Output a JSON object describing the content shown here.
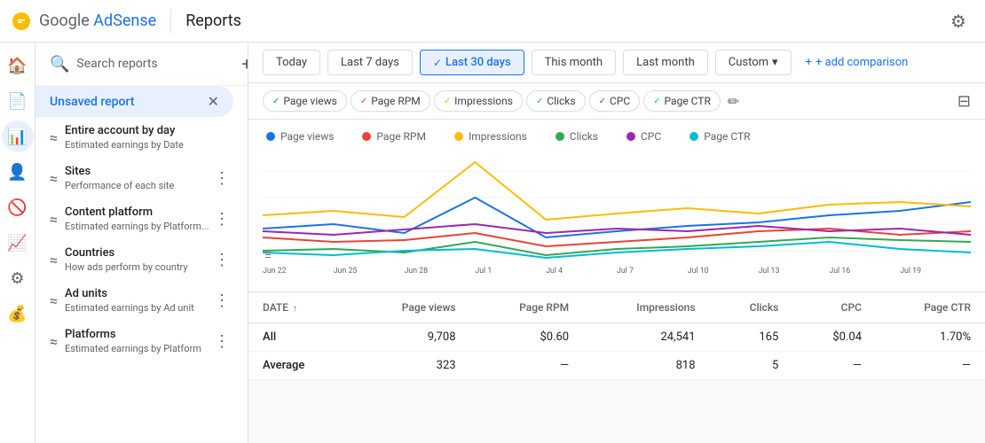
{
  "app": {
    "name": "Google AdSense",
    "page_title": "Reports",
    "settings_label": "Settings"
  },
  "date_filters": {
    "buttons": [
      {
        "id": "today",
        "label": "Today",
        "active": false
      },
      {
        "id": "last7",
        "label": "Last 7 days",
        "active": false
      },
      {
        "id": "last30",
        "label": "Last 30 days",
        "active": true
      },
      {
        "id": "thismonth",
        "label": "This month",
        "active": false
      },
      {
        "id": "lastmonth",
        "label": "Last month",
        "active": false
      },
      {
        "id": "custom",
        "label": "Custom",
        "active": false,
        "dropdown": true
      }
    ],
    "add_comparison_label": "+ add comparison"
  },
  "metric_tabs": [
    {
      "id": "pageviews",
      "label": "Page views",
      "active": true,
      "color": "#1a73e8"
    },
    {
      "id": "pagerpm",
      "label": "Page RPM",
      "active": true,
      "color": "#ea4335"
    },
    {
      "id": "impressions",
      "label": "Impressions",
      "active": true,
      "color": "#fbbc04"
    },
    {
      "id": "clicks",
      "label": "Clicks",
      "active": true,
      "color": "#34a853"
    },
    {
      "id": "cpc",
      "label": "CPC",
      "active": true,
      "color": "#9c27b0"
    },
    {
      "id": "pagectr",
      "label": "Page CTR",
      "active": true,
      "color": "#00bcd4"
    }
  ],
  "chart_legend": [
    {
      "label": "Page views",
      "color": "#1a73e8"
    },
    {
      "label": "Page RPM",
      "color": "#ea4335"
    },
    {
      "label": "Impressions",
      "color": "#fbbc04"
    },
    {
      "label": "Clicks",
      "color": "#34a853"
    },
    {
      "label": "CPC",
      "color": "#9c27b0"
    },
    {
      "label": "Page CTR",
      "color": "#00bcd4"
    }
  ],
  "chart_x_labels": [
    "Jun 22",
    "Jun 25",
    "Jun 28",
    "Jul 1",
    "Jul 4",
    "Jul 7",
    "Jul 10",
    "Jul 13",
    "Jul 16",
    "Jul 19"
  ],
  "table": {
    "columns": [
      "DATE",
      "Page views",
      "Page RPM",
      "Impressions",
      "Clicks",
      "CPC",
      "Page CTR"
    ],
    "rows": [
      {
        "date": "All",
        "pageviews": "9,708",
        "pagerpm": "$0.60",
        "impressions": "24,541",
        "clicks": "165",
        "cpc": "$0.04",
        "pagectr": "1.70%"
      },
      {
        "date": "Average",
        "pageviews": "323",
        "pagerpm": "—",
        "impressions": "818",
        "clicks": "5",
        "cpc": "—",
        "pagectr": "—"
      }
    ]
  },
  "sidebar": {
    "search_placeholder": "Search reports",
    "active_report": "Unsaved report",
    "items": [
      {
        "name": "Entire account by day",
        "desc": "Estimated earnings by Date"
      },
      {
        "name": "Sites",
        "desc": "Performance of each site"
      },
      {
        "name": "Content platform",
        "desc": "Estimated earnings by Platform..."
      },
      {
        "name": "Countries",
        "desc": "How ads perform by country"
      },
      {
        "name": "Ad units",
        "desc": "Estimated earnings by Ad unit"
      },
      {
        "name": "Platforms",
        "desc": "Estimated earnings by Platform"
      }
    ]
  },
  "nav_icons": [
    "home",
    "pages",
    "bar_chart",
    "people",
    "block",
    "analytics",
    "settings",
    "attach_money"
  ],
  "colors": {
    "active_blue": "#1a73e8",
    "accent_red": "#ea4335",
    "accent_yellow": "#fbbc04",
    "accent_green": "#34a853",
    "accent_purple": "#9c27b0",
    "accent_cyan": "#00bcd4"
  }
}
